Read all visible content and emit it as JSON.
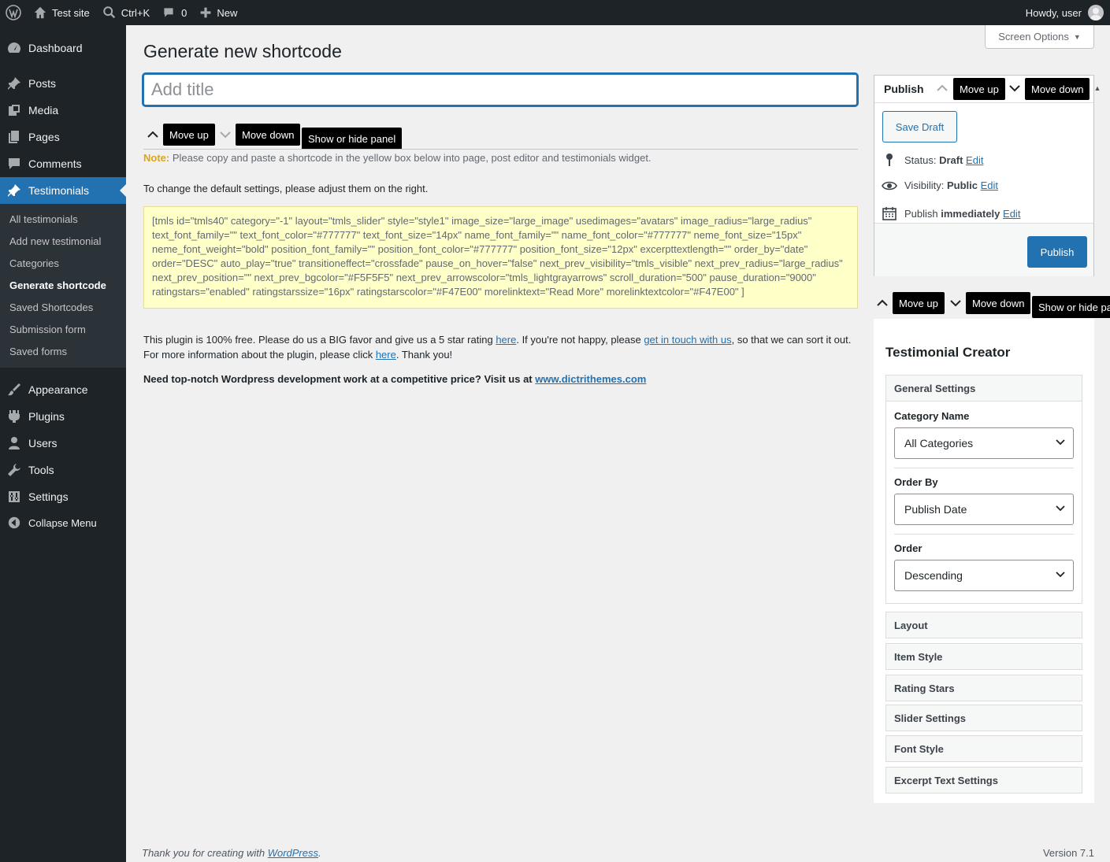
{
  "adminbar": {
    "wp_logo": "wordpress-icon",
    "site_name": "Test site",
    "search_shortcut": "Ctrl+K",
    "comments_count": "0",
    "new_label": "New",
    "howdy": "Howdy, user"
  },
  "sidebar": {
    "items": [
      {
        "label": "Dashboard",
        "icon": "dashboard-icon"
      },
      {
        "label": "Posts",
        "icon": "pin-icon"
      },
      {
        "label": "Media",
        "icon": "media-icon"
      },
      {
        "label": "Pages",
        "icon": "pages-icon"
      },
      {
        "label": "Comments",
        "icon": "comment-icon"
      },
      {
        "label": "Testimonials",
        "icon": "pin-icon"
      },
      {
        "label": "Appearance",
        "icon": "brush-icon"
      },
      {
        "label": "Plugins",
        "icon": "plugin-icon"
      },
      {
        "label": "Users",
        "icon": "users-icon"
      },
      {
        "label": "Tools",
        "icon": "wrench-icon"
      },
      {
        "label": "Settings",
        "icon": "settings-icon"
      },
      {
        "label": "Collapse Menu",
        "icon": "collapse-icon"
      }
    ],
    "submenu": [
      "All testimonials",
      "Add new testimonial",
      "Categories",
      "Generate shortcode",
      "Saved Shortcodes",
      "Submission form",
      "Saved forms"
    ]
  },
  "screen_options": "Screen Options",
  "page_title": "Generate new shortcode",
  "title_placeholder": "Add title",
  "tooltips": {
    "move_up": "Move up",
    "move_down": "Move down",
    "show_hide": "Show or hide panel",
    "show_hide_truncated": "Show or hide pa"
  },
  "note": {
    "label": "Note:",
    "text": " Please copy and paste a shortcode in the yellow box below into page, post editor and testimonials widget."
  },
  "change_text": "To change the default settings, please adjust them on the right.",
  "shortcode": "[tmls id=\"tmls40\" category=\"-1\" layout=\"tmls_slider\" style=\"style1\" image_size=\"large_image\" usedimages=\"avatars\" image_radius=\"large_radius\" text_font_family=\"\" text_font_color=\"#777777\" text_font_size=\"14px\" name_font_family=\"\" name_font_color=\"#777777\" neme_font_size=\"15px\" neme_font_weight=\"bold\" position_font_family=\"\" position_font_color=\"#777777\" position_font_size=\"12px\" excerpttextlength=\"\" order_by=\"date\" order=\"DESC\" auto_play=\"true\" transitioneffect=\"crossfade\" pause_on_hover=\"false\" next_prev_visibility=\"tmls_visible\" next_prev_radius=\"large_radius\" next_prev_position=\"\" next_prev_bgcolor=\"#F5F5F5\" next_prev_arrowscolor=\"tmls_lightgrayarrows\" scroll_duration=\"500\" pause_duration=\"9000\" ratingstars=\"enabled\" ratingstarssize=\"16px\" ratingstarscolor=\"#F47E00\" morelinktext=\"Read More\" morelinktextcolor=\"#F47E00\" ]",
  "plugin_text": {
    "part1": "This plugin is 100% free. Please do us a BIG favor and give us a 5 star rating ",
    "link1": "here",
    "part2": ". If you're not happy, please ",
    "link2": "get in touch with us",
    "part3": ", so that we can sort it out. For more information about the plugin, please click ",
    "link3": "here",
    "part4": ". Thank you!"
  },
  "promo": {
    "text": "Need top-notch Wordpress development work at a competitive price? Visit us at ",
    "link": "www.dictrithemes.com"
  },
  "publish": {
    "title": "Publish",
    "save_draft": "Save Draft",
    "status_label": "Status: ",
    "status_value": "Draft",
    "visibility_label": "Visibility: ",
    "visibility_value": "Public",
    "publish_label": "Publish ",
    "publish_value": "immediately",
    "edit": "Edit",
    "publish_button": "Publish"
  },
  "creator": {
    "title": "Testimonial Creator",
    "general_settings": "General Settings",
    "category_label": "Category Name",
    "category_value": "All Categories",
    "order_by_label": "Order By",
    "order_by_value": "Publish Date",
    "order_label": "Order",
    "order_value": "Descending",
    "sections": [
      "Layout",
      "Item Style",
      "Rating Stars",
      "Slider Settings",
      "Font Style",
      "Excerpt Text Settings"
    ]
  },
  "footer": {
    "text": "Thank you for creating with ",
    "link": "WordPress",
    "end": ".",
    "version": "Version 7.1"
  },
  "colors": {
    "accent": "#2271b1",
    "adminbar": "#1d2327",
    "shortcode_bg": "#ffffc8",
    "note_label": "#dba617"
  }
}
